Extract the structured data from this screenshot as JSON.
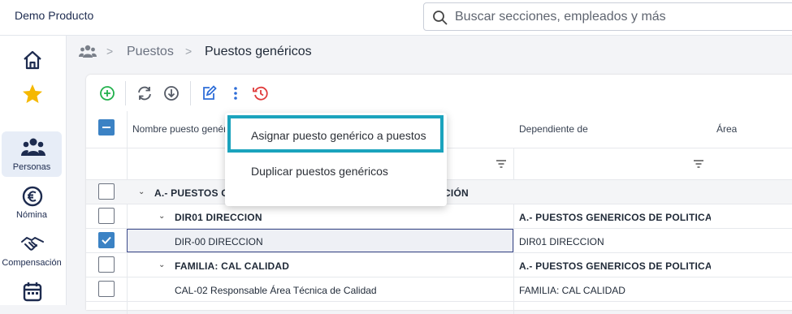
{
  "app": {
    "title": "Demo Producto"
  },
  "search": {
    "placeholder": "Buscar secciones, empleados y más"
  },
  "sidebar": {
    "items": [
      {
        "icon": "home-icon",
        "label": ""
      },
      {
        "icon": "star-icon",
        "label": ""
      },
      {
        "icon": "people-icon",
        "label": "Personas"
      },
      {
        "icon": "euro-icon",
        "label": "Nómina"
      },
      {
        "icon": "handshake-icon",
        "label": "Compensación"
      },
      {
        "icon": "calendar-icon",
        "label": ""
      }
    ],
    "colors": {
      "icon": "#1d2b4f",
      "star": "#f5b800",
      "active_bg": "#e7edf7"
    }
  },
  "breadcrumb": {
    "items": [
      "Puestos",
      "Puestos genéricos"
    ],
    "separator": ">"
  },
  "toolbar": {
    "icons": [
      "add-icon",
      "refresh-icon",
      "download-icon",
      "edit-icon",
      "more-icon",
      "history-icon"
    ],
    "colors": {
      "add": "#22b14c",
      "edit": "#2f6ed8",
      "history": "#e03b3b",
      "neutral": "#555b66"
    }
  },
  "table": {
    "columns": [
      "Nombre puesto genérico",
      "Dependiente de",
      "Área"
    ],
    "rows": [
      {
        "type": "group",
        "level": 0,
        "checked": false,
        "name": "A.- PUESTOS GENERICOS DE POLITICA SALARIAL Y DIRECCIÓN",
        "parent": "",
        "area": ""
      },
      {
        "type": "group",
        "level": 1,
        "checked": false,
        "name": "DIR01 DIRECCION",
        "parent": "A.- PUESTOS GENERICOS DE POLITICA S",
        "area": ""
      },
      {
        "type": "item",
        "level": 2,
        "checked": true,
        "name": "DIR-00 DIRECCION",
        "parent": "DIR01 DIRECCION",
        "area": ""
      },
      {
        "type": "group",
        "level": 1,
        "checked": false,
        "name": "FAMILIA: CAL CALIDAD",
        "parent": "A.- PUESTOS GENERICOS DE POLITICA S",
        "area": ""
      },
      {
        "type": "item",
        "level": 2,
        "checked": false,
        "name": "CAL-02 Responsable Área Técnica de Calidad",
        "parent": "FAMILIA: CAL CALIDAD",
        "area": ""
      }
    ]
  },
  "context_menu": {
    "items": [
      "Asignar puesto genérico a puestos",
      "Duplicar puestos genéricos"
    ],
    "highlight_color": "#1ba3bd"
  }
}
